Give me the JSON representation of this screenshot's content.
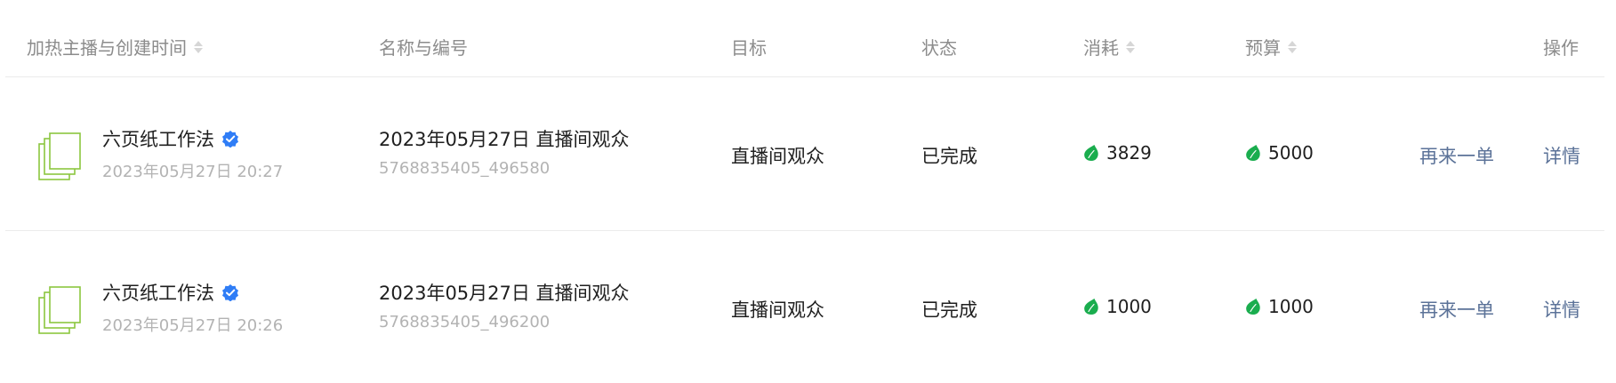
{
  "header": {
    "col_anchor_time": "加热主播与创建时间",
    "col_name_id": "名称与编号",
    "col_target": "目标",
    "col_status": "状态",
    "col_consume": "消耗",
    "col_budget": "预算",
    "col_actions": "操作"
  },
  "rows": [
    {
      "anchor": "六页纸工作法",
      "created": "2023年05月27日 20:27",
      "plan_name": "2023年05月27日 直播间观众",
      "plan_id": "5768835405_496580",
      "target": "直播间观众",
      "status": "已完成",
      "consume": "3829",
      "budget": "5000",
      "reorder_label": "再来一单",
      "detail_label": "详情"
    },
    {
      "anchor": "六页纸工作法",
      "created": "2023年05月27日 20:26",
      "plan_name": "2023年05月27日 直播间观众",
      "plan_id": "5768835405_496200",
      "target": "直播间观众",
      "status": "已完成",
      "consume": "1000",
      "budget": "1000",
      "reorder_label": "再来一单",
      "detail_label": "详情"
    }
  ],
  "colors": {
    "header_text": "#8c8c8c",
    "body_text": "#1f1f1f",
    "muted_text": "#b3b3b3",
    "link": "#5b7298",
    "coin": "#1aad4e",
    "verified": "#2f7df6",
    "thumb_outline": "#8cc63f",
    "divider": "#ebebeb"
  },
  "icons": {
    "sort": "sort-caret-icon",
    "verified": "verified-badge-icon",
    "coin": "leaf-coin-icon",
    "thumbnail": "stacked-pages-icon"
  }
}
